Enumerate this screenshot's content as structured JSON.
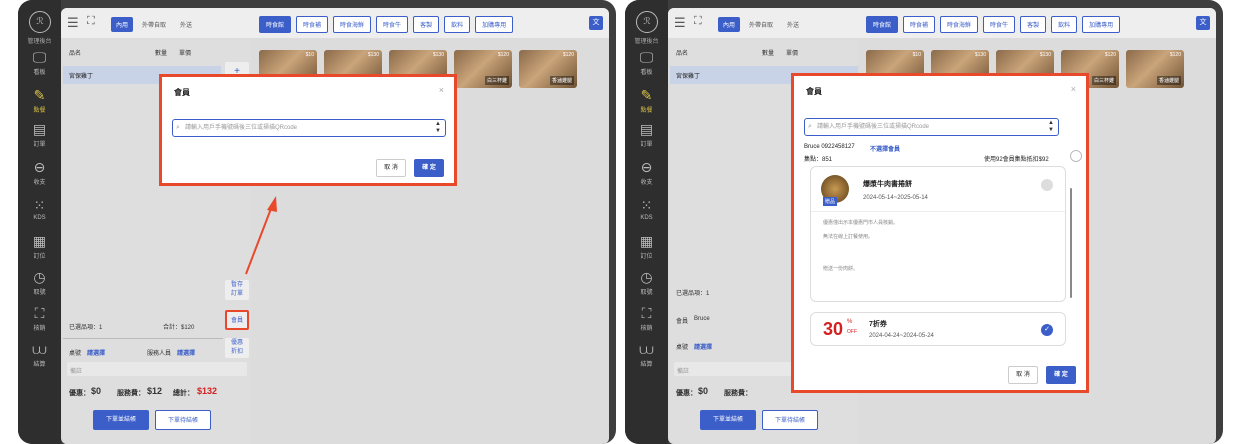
{
  "sidebar": {
    "logo": "ℛ",
    "title": "管理後台",
    "items": [
      {
        "icon": "🖵",
        "label": "看板"
      },
      {
        "icon": "✎",
        "label": "點餐"
      },
      {
        "icon": "▤",
        "label": "訂單"
      },
      {
        "icon": "⊖",
        "label": "收支"
      },
      {
        "icon": "⁙",
        "label": "KDS"
      },
      {
        "icon": "▦",
        "label": "訂位"
      },
      {
        "icon": "◷",
        "label": "取號"
      },
      {
        "icon": "⛶",
        "label": "核銷"
      },
      {
        "icon": "⩊",
        "label": "結算"
      }
    ]
  },
  "topbar": {
    "tabs": [
      "內用",
      "外帶自取",
      "外送"
    ],
    "categories": [
      "時食館",
      "時食補",
      "時食海鮮",
      "時食牛",
      "客製",
      "飲料",
      "加購專用"
    ],
    "lang": "文"
  },
  "order": {
    "col_name": "品名",
    "col_qty": "數量",
    "col_price": "單價",
    "item": "宮保雞丁",
    "selected": "已選品項：1",
    "total": "合計：$120",
    "table_label": "桌號",
    "table_value": "請選擇",
    "server_label": "服務人員",
    "server_value": "請選擇",
    "note": "備註",
    "discount_label": "優惠：",
    "discount": "$0",
    "service_label": "服務費：",
    "service": "$12",
    "grand_label": "總計：",
    "grand": "$132",
    "btn_checkout_now": "下單並結帳",
    "btn_checkout_later": "下單待結帳",
    "member_label": "會員",
    "member_value": "Bruce"
  },
  "rail": {
    "hold": "暫存\n訂單",
    "member": "會員",
    "discount": "優惠\n折扣",
    "plus": "+"
  },
  "goods": [
    {
      "price": "$10",
      "name": ""
    },
    {
      "price": "$130",
      "name": ""
    },
    {
      "price": "$130",
      "name": ""
    },
    {
      "price": "$120",
      "name": "白三杯雞"
    },
    {
      "price": "$120",
      "name": "香滷雞腿"
    }
  ],
  "dialog": {
    "title": "會員",
    "close": "×",
    "placeholder": "請輸入用戶手機號碼後三位或掃描QRcode",
    "cancel": "取 消",
    "ok": "確 定"
  },
  "member": {
    "name_phone": "Bruce 0922458127",
    "unselect": "不選擇會員",
    "points": "集點：851",
    "redeem": "使用92會員集點抵扣$92",
    "coupon1": {
      "badge": "贈品",
      "title": "爆漿牛肉書捲餅",
      "date": "2024-05-14~2025-05-14",
      "desc1": "優惠僅出示本優惠門市人員核銷。",
      "desc2": "無法在線上訂餐使用。",
      "desc3": "贈送一份肉餅。"
    },
    "coupon2": {
      "big": "30",
      "pct": "%",
      "off": "OFF",
      "title": "7折券",
      "date": "2024-04-24~2024-05-24"
    }
  },
  "colors": {
    "accent": "#3b5ec9",
    "highlight": "#e8492b",
    "price": "#d42020"
  }
}
